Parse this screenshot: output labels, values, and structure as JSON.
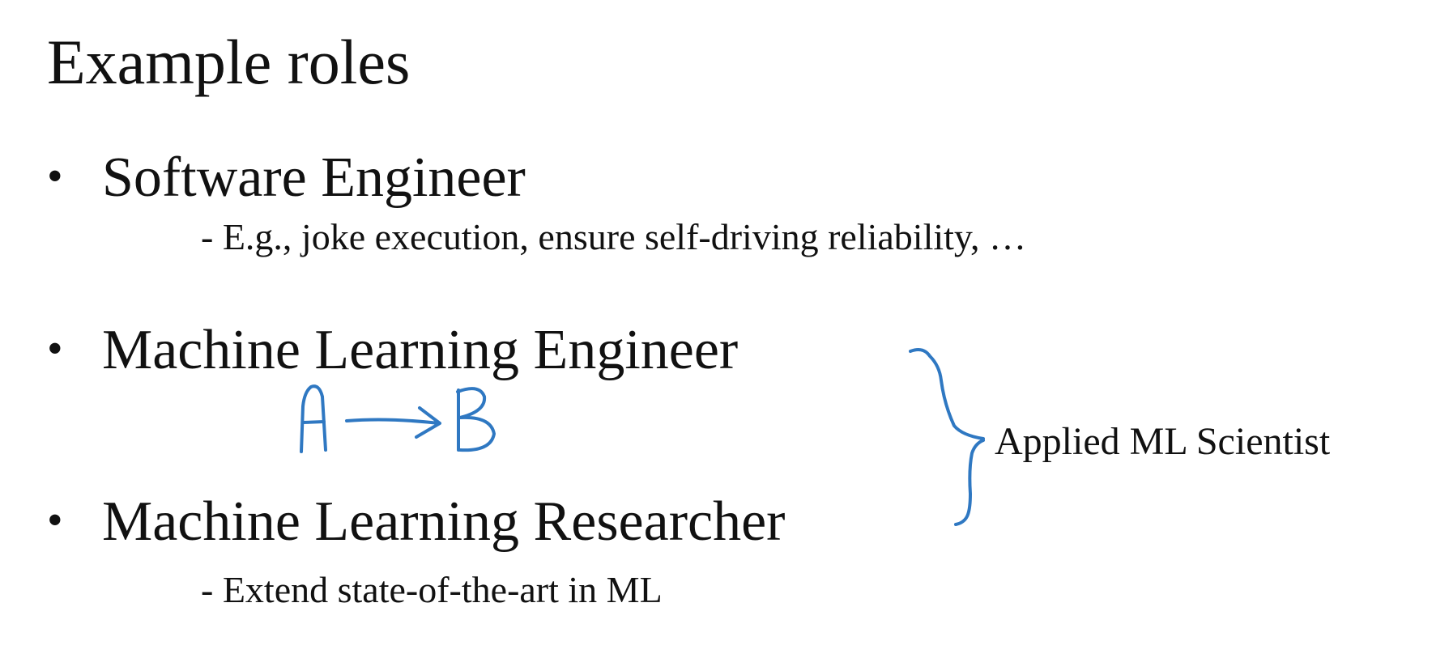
{
  "slide": {
    "title": "Example roles",
    "bullet_symbol": "•",
    "bullets": [
      {
        "label": "Software Engineer",
        "detail": "- E.g., joke execution, ensure self-driving reliability, …"
      },
      {
        "label": "Machine Learning Engineer",
        "detail": ""
      },
      {
        "label": "Machine Learning Researcher",
        "detail": "- Extend state-of-the-art in ML"
      }
    ],
    "brace_label": "Applied ML Scientist",
    "handwriting": {
      "left_letter": "A",
      "right_letter": "B",
      "ink_color": "#2f78c2"
    }
  }
}
